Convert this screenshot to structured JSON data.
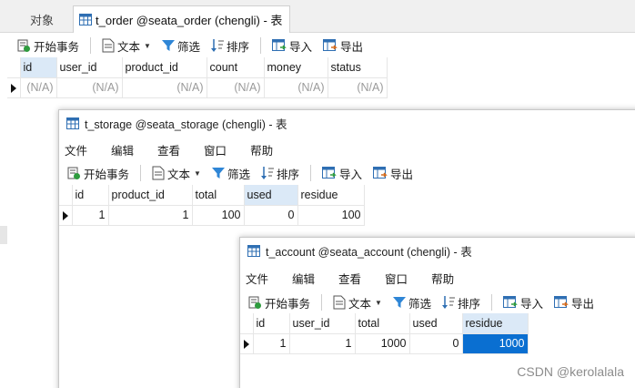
{
  "tabs": {
    "objects_label": "对象",
    "order_tab_label": "t_order @seata_order (chengli) - 表"
  },
  "toolbar": {
    "begin_tx": "开始事务",
    "text": "文本",
    "filter": "筛选",
    "sort": "排序",
    "import": "导入",
    "export": "导出"
  },
  "menu": {
    "file": "文件",
    "edit": "编辑",
    "view": "查看",
    "window": "窗口",
    "help": "帮助"
  },
  "order": {
    "columns": [
      "id",
      "user_id",
      "product_id",
      "count",
      "money",
      "status"
    ],
    "row": [
      "(N/A)",
      "(N/A)",
      "(N/A)",
      "(N/A)",
      "(N/A)",
      "(N/A)"
    ]
  },
  "storage": {
    "title": "t_storage @seata_storage (chengli) - 表",
    "columns": [
      "id",
      "product_id",
      "total",
      "used",
      "residue"
    ],
    "row": [
      "1",
      "1",
      "100",
      "0",
      "100"
    ]
  },
  "account": {
    "title": "t_account @seata_account (chengli) - 表",
    "columns": [
      "id",
      "user_id",
      "total",
      "used",
      "residue"
    ],
    "row": [
      "1",
      "1",
      "1000",
      "0",
      "1000"
    ]
  },
  "watermark": "CSDN @kerolalala",
  "colors": {
    "selected_cell": "#0a6fd1",
    "highlight_header": "#dbe9f7"
  }
}
